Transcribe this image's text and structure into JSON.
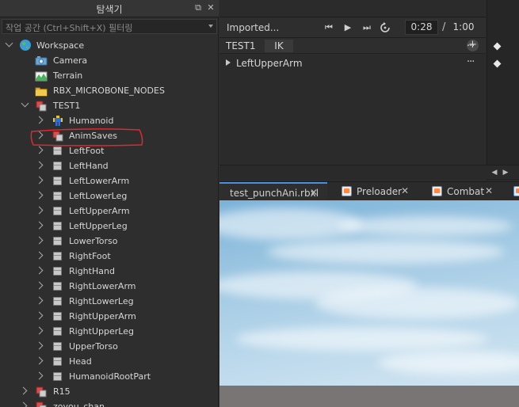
{
  "explorer": {
    "title": "탐색기",
    "filter_placeholder": "작업 공간 (Ctrl+Shift+X) 필터링",
    "items": [
      {
        "label": "Workspace",
        "icon": "globe-icon"
      },
      {
        "label": "Camera",
        "icon": "camera-icon"
      },
      {
        "label": "Terrain",
        "icon": "terrain-icon"
      },
      {
        "label": "RBX_MICROBONE_NODES",
        "icon": "folder-icon"
      },
      {
        "label": "TEST1",
        "icon": "model-icon"
      },
      {
        "label": "Humanoid",
        "icon": "humanoid-icon"
      },
      {
        "label": "AnimSaves",
        "icon": "model-icon"
      },
      {
        "label": "LeftFoot",
        "icon": "part-icon"
      },
      {
        "label": "LeftHand",
        "icon": "part-icon"
      },
      {
        "label": "LeftLowerArm",
        "icon": "part-icon"
      },
      {
        "label": "LeftLowerLeg",
        "icon": "part-icon"
      },
      {
        "label": "LeftUpperArm",
        "icon": "part-icon"
      },
      {
        "label": "LeftUpperLeg",
        "icon": "part-icon"
      },
      {
        "label": "LowerTorso",
        "icon": "part-icon"
      },
      {
        "label": "RightFoot",
        "icon": "part-icon"
      },
      {
        "label": "RightHand",
        "icon": "part-icon"
      },
      {
        "label": "RightLowerArm",
        "icon": "part-icon"
      },
      {
        "label": "RightLowerLeg",
        "icon": "part-icon"
      },
      {
        "label": "RightUpperArm",
        "icon": "part-icon"
      },
      {
        "label": "RightUpperLeg",
        "icon": "part-icon"
      },
      {
        "label": "UpperTorso",
        "icon": "part-icon"
      },
      {
        "label": "Head",
        "icon": "part-icon"
      },
      {
        "label": "HumanoidRootPart",
        "icon": "part-icon"
      },
      {
        "label": "R15",
        "icon": "model-icon"
      },
      {
        "label": "zoyou_chan",
        "icon": "model-icon"
      }
    ]
  },
  "animation_editor": {
    "animation_name": "Imported...",
    "current_time": "0:28",
    "time_separator": "/",
    "end_time": "1:00",
    "rig_name": "TEST1",
    "ik_label": "IK",
    "add_label": "+",
    "track_label": "LeftUpperArm",
    "more_label": "···"
  },
  "document_tabs": [
    {
      "label": "test_punchAni.rbxl",
      "close": "✕",
      "active": true
    },
    {
      "label": "Preloader",
      "close": "✕",
      "active": false
    },
    {
      "label": "Combat",
      "close": "✕",
      "active": false
    }
  ],
  "colors": {
    "highlight_annotation": "#e0282e",
    "active_tab_accent": "#4a90e2"
  }
}
